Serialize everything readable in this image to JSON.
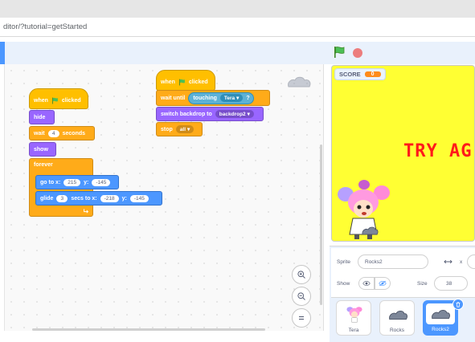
{
  "browser": {
    "url": "ditor/?tutorial=getStarted"
  },
  "score": {
    "label": "SCORE",
    "value": "0"
  },
  "stage": {
    "message": "TRY AG"
  },
  "sprite_info": {
    "sprite_label": "Sprite",
    "sprite_name": "Rocks2",
    "x_label": "x",
    "show_label": "Show",
    "size_label": "Size",
    "size_value": "38"
  },
  "sprites": [
    {
      "name": "Tera"
    },
    {
      "name": "Rocks"
    },
    {
      "name": "Rocks2",
      "selected": true
    }
  ],
  "scripts": {
    "a": {
      "when": "when",
      "clicked": "clicked",
      "hide": "hide",
      "wait": "wait",
      "wait_value": "4",
      "seconds": "seconds",
      "show": "show",
      "forever": "forever",
      "goto": "go to x:",
      "goto_x": "215",
      "y": "y:",
      "goto_y": "-145",
      "glide": "glide",
      "glide_secs": "3",
      "secs_to": "secs to x:",
      "glide_x": "-218",
      "glide_y": "-145"
    },
    "b": {
      "when": "when",
      "clicked": "clicked",
      "wait_until": "wait until",
      "touching": "touching",
      "touching_target": "Tera",
      "q": "?",
      "switch_backdrop": "switch backdrop to",
      "backdrop": "backdrop2",
      "stop": "stop",
      "stop_option": "all"
    }
  },
  "colors": {
    "events": "#ffbf00",
    "control": "#ffab19",
    "looks": "#9966ff",
    "motion": "#4c97ff",
    "sensing": "#5cb1d6",
    "stage_bg": "#ffff33",
    "try_text": "#ff1a1a"
  },
  "icons": [
    "green-flag-icon",
    "stop-icon",
    "zoom-in-icon",
    "zoom-out-icon",
    "zoom-reset-icon",
    "eye-icon",
    "eye-hidden-icon",
    "trash-icon",
    "arrows-x-icon",
    "dropdown-arrow-icon",
    "loop-arrow-icon"
  ]
}
